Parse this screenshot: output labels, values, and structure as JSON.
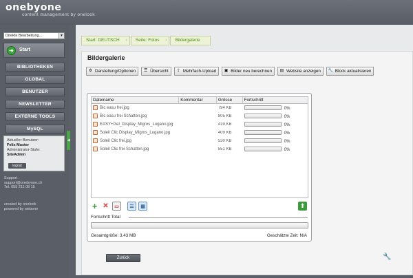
{
  "brand": {
    "logo": "onebyone",
    "tagline": "content management by onelook"
  },
  "sidebar": {
    "select_value": "Direkte Bearbeitung...",
    "start_label": "Start",
    "nav": [
      "BIBLIOTHEKEN",
      "GLOBAL",
      "BENUTZER",
      "NEWSLETTER",
      "EXTERNE TOOLS",
      "MySQL"
    ],
    "user": {
      "current_label": "Aktueller Benutzer:",
      "name": "Felix Muster",
      "level_label": "Administrator-Stufe:",
      "level": "SiteAdmin",
      "logout": "logout"
    },
    "support": [
      "Support",
      "support@onebyone.ch",
      "Tel. 055 211 08 15"
    ],
    "credits": [
      "created by onelook",
      "powered by webone"
    ]
  },
  "breadcrumb": [
    "Start: DEUTSCH",
    "Seite: Fotos",
    "Bildergalerie"
  ],
  "page": {
    "title": "Bildergalerie"
  },
  "toolbar": [
    {
      "label": "Darstellung/Optionen",
      "icon": "gear-icon"
    },
    {
      "label": "Übersicht",
      "icon": "list-icon"
    },
    {
      "label": "Mehrfach-Upload",
      "icon": "upload-icon"
    },
    {
      "label": "Bilder neu berechnen",
      "icon": "image-icon"
    },
    {
      "label": "Website anzeigen",
      "icon": "page-icon"
    },
    {
      "label": "Block aktualisieren",
      "icon": "wrench-icon"
    }
  ],
  "upload": {
    "columns": [
      "Dateiname",
      "Kommentar",
      "Grösse",
      "Fortschritt"
    ],
    "files": [
      {
        "name": "Bic easu frei.jpg",
        "comment": "",
        "size": "794 KB",
        "progress": "0%",
        "progress_value": 0
      },
      {
        "name": "Bic easu frei Schatten.jpg",
        "comment": "",
        "size": "805 KB",
        "progress": "0%",
        "progress_value": 0
      },
      {
        "name": "EASY+Gel_Display_Migros_Lugano.jpg",
        "comment": "",
        "size": "419 KB",
        "progress": "0%",
        "progress_value": 0
      },
      {
        "name": "Soleil Clic Display_Migros_Lugano.jpg",
        "comment": "",
        "size": "409 KB",
        "progress": "0%",
        "progress_value": 0
      },
      {
        "name": "Soleil Clic frei.jpg",
        "comment": "",
        "size": "530 KB",
        "progress": "0%",
        "progress_value": 0
      },
      {
        "name": "Soleil Clic frei Schatten.jpg",
        "comment": "",
        "size": "551 KB",
        "progress": "0%",
        "progress_value": 0
      }
    ],
    "total_label": "Fortschritt Total",
    "total_progress_value": 0,
    "total_size": "Gesamtgröße: 3.43 MB",
    "remaining_time": "Geschätzte Zeit: N/A"
  },
  "back_button": "Zurück",
  "colors": {
    "accent_green": "#4aa44a",
    "breadcrumb_text": "#4a8a15",
    "sidebar_bg": "#5a5e66"
  }
}
